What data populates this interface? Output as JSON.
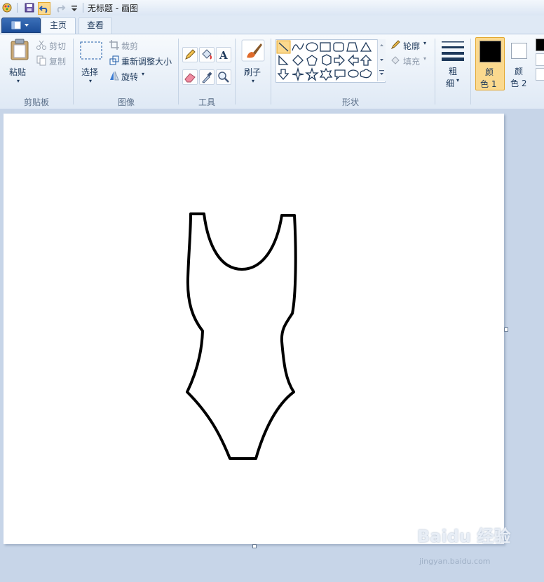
{
  "window": {
    "title": "无标题 - 画图"
  },
  "tabs": {
    "home": "主页",
    "view": "查看"
  },
  "clipboard": {
    "paste": "粘贴",
    "cut": "剪切",
    "copy": "复制",
    "group": "剪贴板"
  },
  "image": {
    "select": "选择",
    "crop": "裁剪",
    "resize": "重新调整大小",
    "rotate": "旋转",
    "group": "图像"
  },
  "tools": {
    "group": "工具"
  },
  "brushes": {
    "label": "刷子"
  },
  "shapes": {
    "outline": "轮廓",
    "fill": "填充",
    "group": "形状"
  },
  "size": {
    "label_line1": "粗",
    "label_line2": "细"
  },
  "colors": {
    "color1_line1": "颜",
    "color1_line2": "色 1",
    "color2_line1": "颜",
    "color2_line2": "色 2",
    "color1_value": "#000000",
    "color2_value": "#ffffff"
  },
  "watermark": {
    "brand": "Baidu 经验",
    "url": "jingyan.baidu.com"
  }
}
